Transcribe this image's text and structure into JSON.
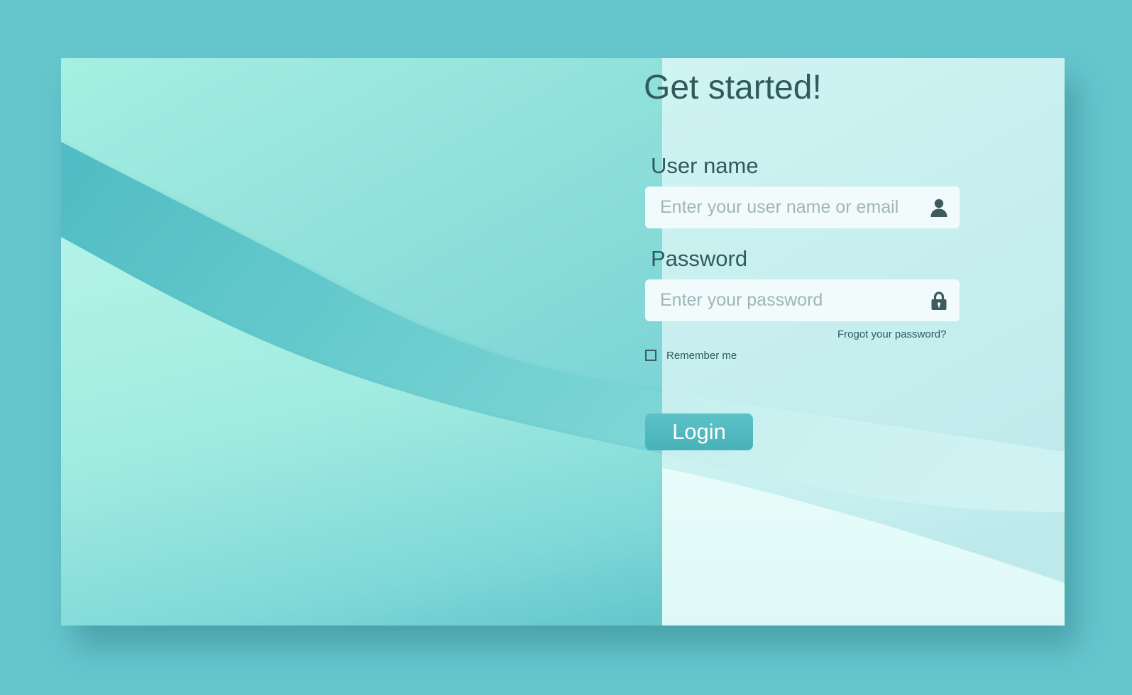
{
  "form": {
    "title": "Get started!",
    "username": {
      "label": "User name",
      "placeholder": "Enter your user name or email",
      "value": "",
      "icon": "user-icon"
    },
    "password": {
      "label": "Password",
      "placeholder": "Enter your password",
      "value": "",
      "icon": "lock-icon"
    },
    "forgot_link": "Frogot your password?",
    "remember_label": "Remember me",
    "remember_checked": false,
    "login_label": "Login"
  },
  "colors": {
    "page_background": "#66c6ce",
    "text": "#2f5b5e",
    "accent": "#4bb7bd",
    "input_background": "#f1fbfc"
  }
}
